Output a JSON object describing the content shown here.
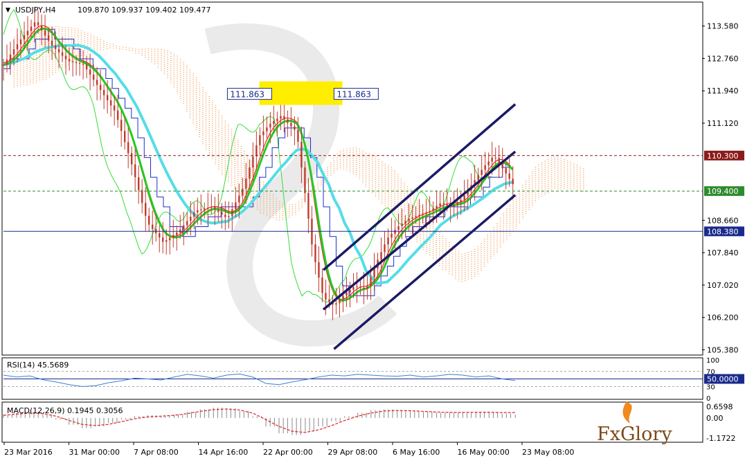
{
  "header": {
    "symbol": "USDJPY,H4",
    "ohlc": "109.870 109.937 109.402 109.477"
  },
  "colors": {
    "candle": "#c0392b",
    "ichimoku_orange": "#f0a060",
    "ichimoku_lilac": "#c9a8c9",
    "chikou": "#33dd33",
    "tenkan": "#ee2222",
    "kijun": "#1a2ecc",
    "ma_fast": "#22cc22",
    "ma_slow": "#55dde8",
    "channel": "#1a1a66",
    "tag_red": "#8b1a1a",
    "tag_green": "#2e8b2e",
    "tag_blue": "#1a2a8c",
    "highlight": "#ffee00",
    "rsi_line": "#3a7fd5",
    "macd_hist": "#888888",
    "macd_signal": "#dd2222"
  },
  "chart_data": [
    {
      "type": "line",
      "panel": "price",
      "y_ticks": [
        "113.580",
        "112.760",
        "111.940",
        "111.120",
        "110.300",
        "109.400",
        "108.660",
        "108.380",
        "107.840",
        "107.020",
        "106.200",
        "105.380"
      ],
      "ylim": [
        105.3,
        114.1
      ],
      "x_ticks": [
        "23 Mar 2016",
        "31 Mar 00:00",
        "7 Apr 08:00",
        "14 Apr 16:00",
        "22 Apr 00:00",
        "29 Apr 08:00",
        "6 May 16:00",
        "16 May 00:00",
        "23 May 08:00"
      ],
      "levels": [
        {
          "label": "110.300",
          "value": 110.3,
          "style": "dashed",
          "color": "#8b1a1a"
        },
        {
          "label": "109.400",
          "value": 109.4,
          "style": "dashed",
          "color": "#2e8b2e"
        },
        {
          "label": "108.380",
          "value": 108.38,
          "style": "solid",
          "color": "#1a2a8c"
        }
      ],
      "annotations": [
        {
          "label": "111.863",
          "value": 111.863,
          "position": "left"
        },
        {
          "label": "111.863",
          "value": 111.863,
          "position": "right"
        }
      ],
      "channel": [
        {
          "x": [
            0.6,
            0.96
          ],
          "y": [
            107.4,
            111.6
          ]
        },
        {
          "x": [
            0.6,
            0.96
          ],
          "y": [
            106.4,
            110.4
          ]
        },
        {
          "x": [
            0.62,
            0.96
          ],
          "y": [
            105.4,
            109.3
          ]
        }
      ],
      "price_path": {
        "x": [
          0.0,
          0.03,
          0.06,
          0.09,
          0.12,
          0.15,
          0.18,
          0.21,
          0.24,
          0.27,
          0.3,
          0.33,
          0.36,
          0.39,
          0.42,
          0.45,
          0.48,
          0.5,
          0.52,
          0.55,
          0.58,
          0.6,
          0.62,
          0.64,
          0.66,
          0.68,
          0.7,
          0.72,
          0.74,
          0.76,
          0.78,
          0.8,
          0.82,
          0.84,
          0.86,
          0.88,
          0.9,
          0.92,
          0.94,
          0.96
        ],
        "y": [
          112.6,
          113.2,
          113.7,
          113.1,
          112.7,
          112.6,
          112.0,
          111.4,
          110.1,
          108.6,
          108.1,
          108.4,
          108.9,
          109.0,
          108.7,
          109.5,
          110.8,
          111.1,
          111.3,
          110.9,
          107.9,
          106.7,
          106.5,
          106.8,
          107.0,
          106.9,
          107.6,
          108.2,
          108.5,
          108.7,
          108.8,
          108.9,
          109.1,
          109.0,
          109.2,
          109.6,
          110.0,
          110.3,
          109.9,
          109.48
        ]
      }
    },
    {
      "type": "line",
      "panel": "rsi",
      "title": "RSI(14) 45.5689",
      "y_ticks": [
        "100",
        "70",
        "50.0000",
        "30",
        "0"
      ],
      "ylim": [
        0,
        100
      ],
      "levels": [
        70,
        50,
        30
      ],
      "values": [
        60,
        55,
        58,
        48,
        42,
        35,
        30,
        32,
        40,
        45,
        52,
        50,
        47,
        55,
        62,
        58,
        52,
        60,
        63,
        55,
        38,
        35,
        42,
        48,
        55,
        60,
        58,
        62,
        60,
        58,
        57,
        60,
        55,
        58,
        62,
        60,
        55,
        58,
        50,
        45.57
      ]
    },
    {
      "type": "bar",
      "panel": "macd",
      "title": "MACD(12,26,9) 0.1945 0.3056",
      "y_ticks": [
        "0.6598",
        "0.00",
        "-1.1722"
      ],
      "ylim": [
        -1.3,
        0.8
      ],
      "histogram": [
        0.2,
        0.3,
        0.35,
        0.2,
        -0.1,
        -0.4,
        -0.6,
        -0.5,
        -0.3,
        -0.1,
        0.1,
        0.15,
        0.1,
        0.2,
        0.35,
        0.5,
        0.6,
        0.55,
        0.4,
        0.1,
        -0.5,
        -0.9,
        -1.0,
        -0.8,
        -0.5,
        -0.2,
        0.1,
        0.3,
        0.45,
        0.5,
        0.45,
        0.4,
        0.35,
        0.3,
        0.3,
        0.32,
        0.35,
        0.33,
        0.25,
        0.19
      ],
      "signal": [
        0.15,
        0.22,
        0.28,
        0.25,
        0.1,
        -0.15,
        -0.38,
        -0.45,
        -0.38,
        -0.22,
        -0.05,
        0.06,
        0.1,
        0.15,
        0.25,
        0.38,
        0.48,
        0.52,
        0.46,
        0.28,
        -0.1,
        -0.5,
        -0.78,
        -0.85,
        -0.7,
        -0.45,
        -0.15,
        0.1,
        0.28,
        0.4,
        0.43,
        0.42,
        0.38,
        0.34,
        0.32,
        0.32,
        0.33,
        0.33,
        0.31,
        0.31
      ]
    }
  ],
  "brand": {
    "logo_text": "FxGlory"
  }
}
